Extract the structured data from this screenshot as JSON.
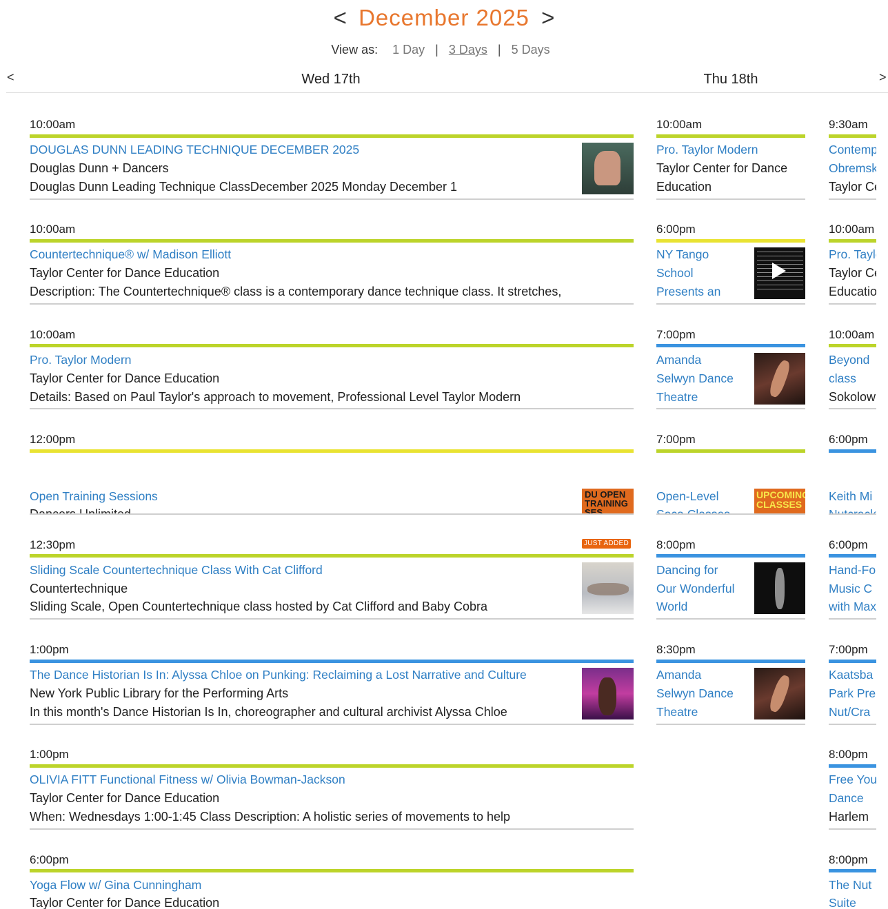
{
  "nav": {
    "prev_month": "<",
    "month": "December 2025",
    "next_month": ">"
  },
  "view": {
    "label": "View as:",
    "options": [
      "1 Day",
      "3 Days",
      "5 Days"
    ],
    "active": "3 Days",
    "separator": "|"
  },
  "days": {
    "prev": "<",
    "next": ">",
    "headers": [
      "Wed 17th",
      "Thu 18th"
    ]
  },
  "colors": {
    "accent": "#e8772e",
    "link": "#2f7fc4",
    "bar_green": "#bcd42a",
    "bar_yellow": "#e9e332",
    "bar_blue": "#3a93e0",
    "badge": "#e8650f"
  },
  "wed": [
    {
      "time": "10:00am",
      "title": "DOUGLAS DUNN LEADING TECHNIQUE DECEMBER 2025",
      "venue": "Douglas Dunn + Dancers",
      "desc": "Douglas Dunn Leading Technique ClassDecember 2025 Monday December 1"
    },
    {
      "time": "10:00am",
      "title": "Countertechnique® w/ Madison Elliott",
      "venue": "Taylor Center for Dance Education",
      "desc": "Description: The Countertechnique® class is a contemporary dance technique class. It stretches,"
    },
    {
      "time": "10:00am",
      "title": "Pro. Taylor Modern",
      "venue": "Taylor Center for Dance Education",
      "desc": "Details: Based on Paul Taylor's approach to movement, Professional Level Taylor Modern"
    },
    {
      "time": "12:00pm",
      "title": "Open Training Sessions",
      "venue": "Dancers Unlimited",
      "desc": ""
    },
    {
      "time": "12:30pm",
      "badge": "JUST ADDED",
      "title": "Sliding Scale Countertechnique Class With Cat Clifford",
      "venue": "Countertechnique",
      "desc": "Sliding Scale, Open Countertechnique class hosted by Cat Clifford and Baby Cobra"
    },
    {
      "time": "1:00pm",
      "title": "The Dance Historian Is In: Alyssa Chloe on Punking: Reclaiming a Lost Narrative and Culture",
      "venue": "New York Public Library for the Performing Arts",
      "desc": "In this month's Dance Historian Is In, choreographer and cultural archivist Alyssa Chloe"
    },
    {
      "time": "1:00pm",
      "title": "OLIVIA FITT Functional Fitness w/ Olivia Bowman-Jackson",
      "venue": "Taylor Center for Dance Education",
      "desc": "When:  Wednesdays 1:00-1:45   Class Description:  A holistic series of movements to help"
    },
    {
      "time": "6:00pm",
      "title": "Yoga Flow w/ Gina Cunningham",
      "venue": "Taylor Center for Dance Education",
      "desc": ""
    }
  ],
  "thu": [
    {
      "time": "10:00am",
      "lines": [
        "Pro. Taylor Modern"
      ],
      "venue": [
        "Taylor Center for Dance",
        "Education"
      ]
    },
    {
      "time": "6:00pm",
      "lines": [
        "NY Tango",
        "School",
        "Presents an"
      ],
      "venue": []
    },
    {
      "time": "7:00pm",
      "lines": [
        "Amanda",
        "Selwyn Dance",
        "Theatre"
      ],
      "venue": []
    },
    {
      "time": "7:00pm",
      "lines": [
        "Open-Level",
        "Soca Classes"
      ],
      "venue": []
    },
    {
      "time": "8:00pm",
      "lines": [
        "Dancing for",
        "Our Wonderful",
        "World"
      ],
      "venue": []
    },
    {
      "time": "8:30pm",
      "lines": [
        "Amanda",
        "Selwyn Dance",
        "Theatre"
      ],
      "venue": []
    }
  ],
  "fri": [
    {
      "time": "9:30am",
      "lines": [
        "Contemporary",
        "Obremski"
      ],
      "venue": [
        "Taylor Center"
      ]
    },
    {
      "time": "10:00am",
      "lines": [
        "Pro. Taylor"
      ],
      "venue": [
        "Taylor Center",
        "Education"
      ]
    },
    {
      "time": "10:00am",
      "lines": [
        "Beyond",
        "class"
      ],
      "venue": [
        "Sokolow"
      ]
    },
    {
      "time": "6:00pm",
      "lines": [
        "Keith Mi",
        "Nutcracker"
      ],
      "venue": []
    },
    {
      "time": "6:00pm",
      "lines": [
        "Hand-Fo",
        "Music C",
        "with Max"
      ],
      "venue": []
    },
    {
      "time": "7:00pm",
      "lines": [
        "Kaatsba",
        "Park Pre",
        "Nut/Cra"
      ],
      "venue": []
    },
    {
      "time": "8:00pm",
      "lines": [
        "Free You",
        "Dance"
      ],
      "venue": [
        "Harlem"
      ]
    },
    {
      "time": "8:00pm",
      "lines": [
        "The Nut",
        "Suite"
      ],
      "venue": []
    }
  ]
}
